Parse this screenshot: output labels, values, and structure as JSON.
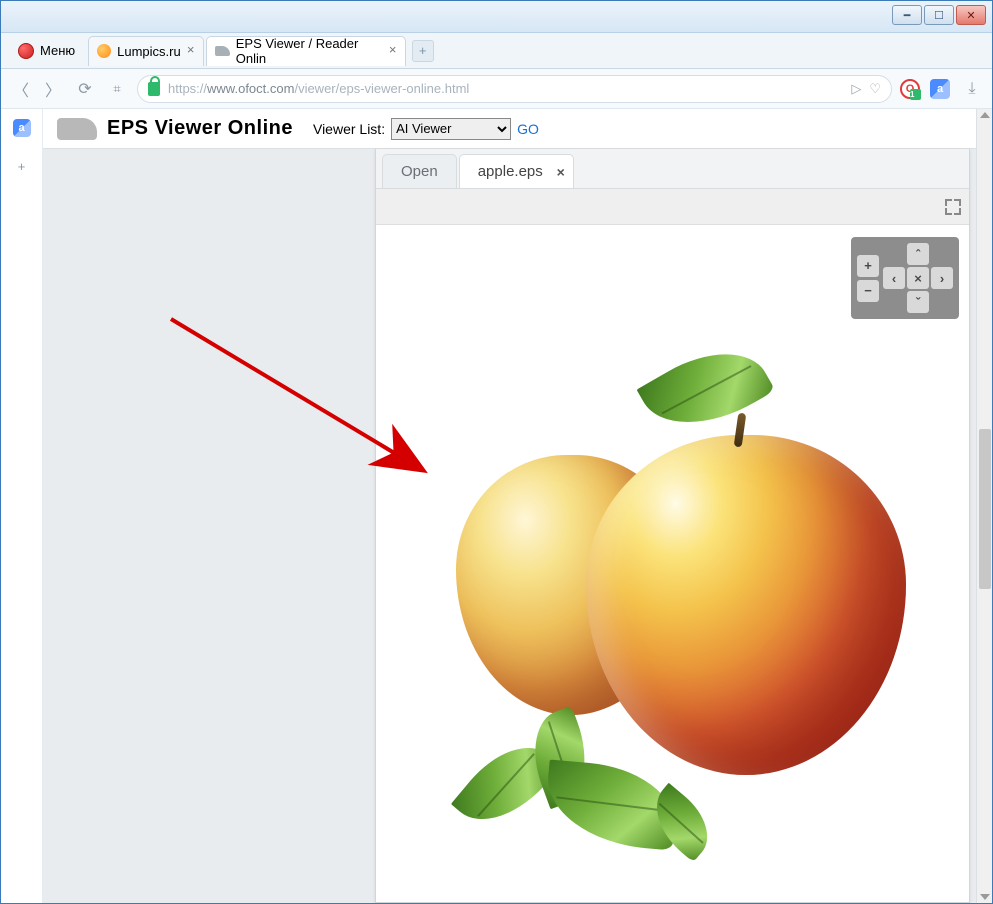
{
  "window": {
    "menu_label": "Меню"
  },
  "tabs": [
    {
      "title": "Lumpics.ru",
      "active": false
    },
    {
      "title": "EPS Viewer / Reader Onlin",
      "active": true
    }
  ],
  "address": {
    "scheme": "https://",
    "host": "www.ofoct.com",
    "path": "/viewer/eps-viewer-online.html",
    "ext_badge": "1"
  },
  "page": {
    "title": "EPS Viewer Online",
    "viewer_list_label": "Viewer List:",
    "viewer_selected": "AI Viewer",
    "viewer_options": [
      "AI Viewer"
    ],
    "go_label": "GO"
  },
  "viewer": {
    "tabs": [
      {
        "label": "Open",
        "active": false
      },
      {
        "label": "apple.eps",
        "active": true
      }
    ],
    "controls": {
      "zoom_in": "+",
      "zoom_out": "−",
      "pan_up": "ˆ",
      "pan_down": "ˇ",
      "pan_left": "‹",
      "pan_right": "›",
      "reset": "×"
    }
  }
}
